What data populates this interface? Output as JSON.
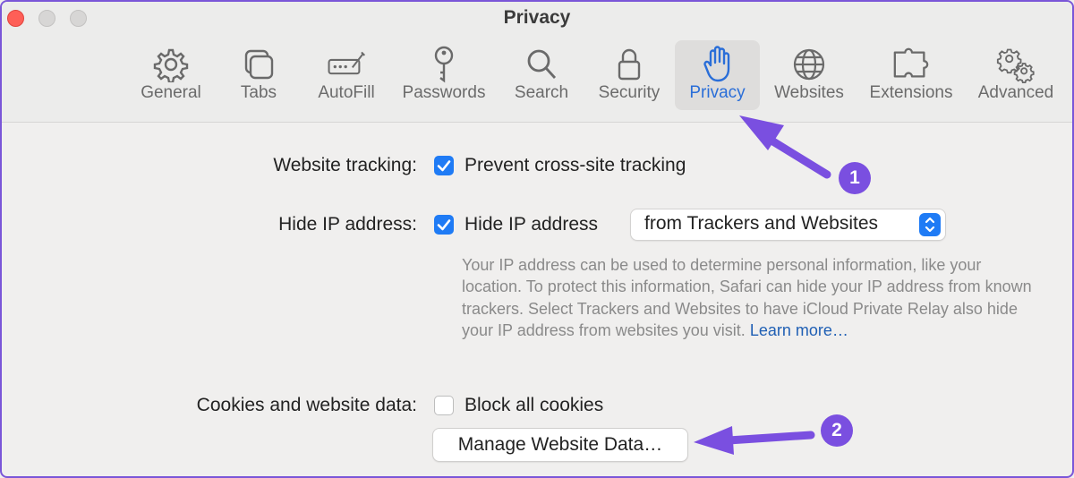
{
  "window": {
    "title": "Privacy",
    "traffic_lights": [
      "close",
      "minimize",
      "zoom"
    ]
  },
  "toolbar": {
    "tabs": [
      {
        "label": "General",
        "icon": "gear-icon"
      },
      {
        "label": "Tabs",
        "icon": "tabs-icon"
      },
      {
        "label": "AutoFill",
        "icon": "autofill-icon"
      },
      {
        "label": "Passwords",
        "icon": "key-icon"
      },
      {
        "label": "Search",
        "icon": "search-icon"
      },
      {
        "label": "Security",
        "icon": "lock-icon"
      },
      {
        "label": "Privacy",
        "icon": "hand-icon",
        "selected": true
      },
      {
        "label": "Websites",
        "icon": "globe-icon"
      },
      {
        "label": "Extensions",
        "icon": "puzzle-icon"
      },
      {
        "label": "Advanced",
        "icon": "gears-icon"
      }
    ]
  },
  "settings": {
    "website_tracking": {
      "label": "Website tracking:",
      "option": "Prevent cross-site tracking",
      "checked": true
    },
    "hide_ip": {
      "label": "Hide IP address:",
      "option": "Hide IP address",
      "checked": true,
      "select_value": "from Trackers and Websites",
      "help_text": "Your IP address can be used to determine personal information, like your location. To protect this information, Safari can hide your IP address from known trackers. Select Trackers and Websites to have iCloud Private Relay also hide your IP address from websites you visit.",
      "learn_more": "Learn more…"
    },
    "cookies": {
      "label": "Cookies and website data:",
      "option": "Block all cookies",
      "checked": false,
      "button": "Manage Website Data…"
    }
  },
  "annotations": [
    {
      "number": "1",
      "target": "Privacy tab"
    },
    {
      "number": "2",
      "target": "Manage Website Data… button"
    }
  ],
  "colors": {
    "accent": "#1f7bf5",
    "annotation": "#7a4fe0",
    "link": "#1f5fb4",
    "selected_tab_label": "#2a6ed8"
  }
}
